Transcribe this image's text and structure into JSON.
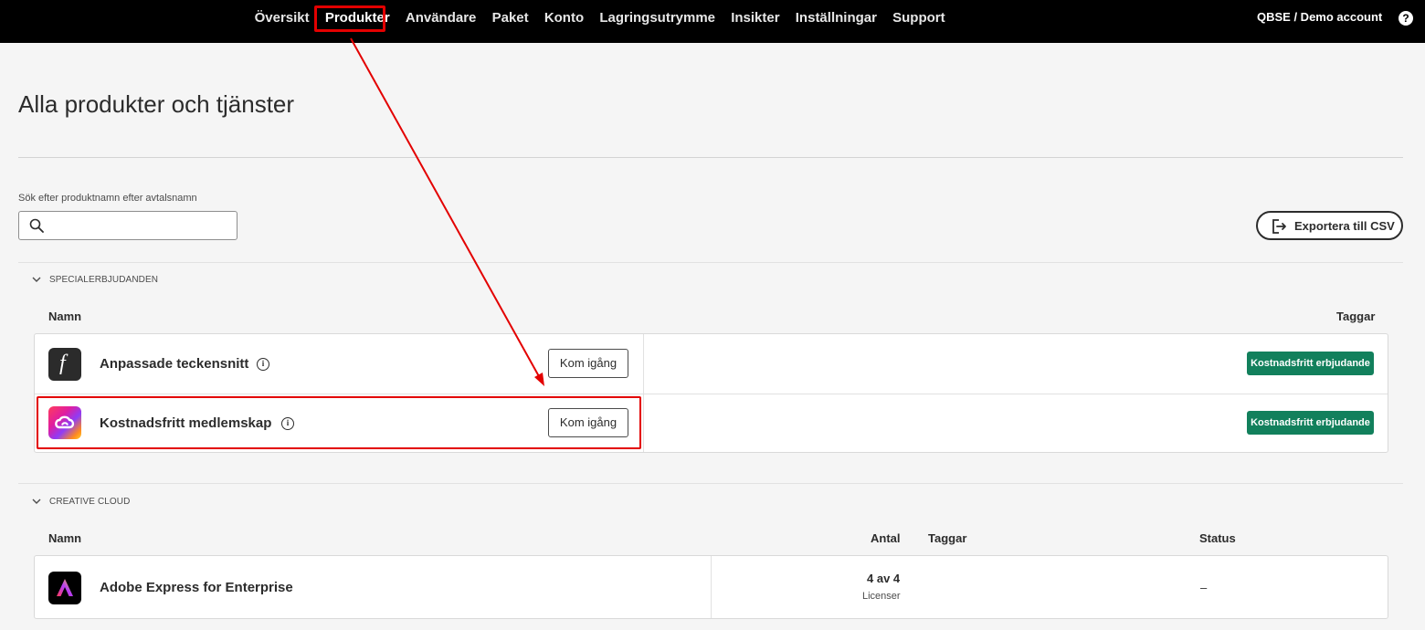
{
  "nav": {
    "items": [
      {
        "label": "Översikt"
      },
      {
        "label": "Produkter"
      },
      {
        "label": "Användare"
      },
      {
        "label": "Paket"
      },
      {
        "label": "Konto"
      },
      {
        "label": "Lagringsutrymme"
      },
      {
        "label": "Insikter"
      },
      {
        "label": "Inställningar"
      },
      {
        "label": "Support"
      }
    ],
    "active": "Produkter",
    "account": "QBSE / Demo account",
    "help": "?"
  },
  "page": {
    "title": "Alla produkter och tjänster",
    "search_label": "Sök efter produktnamn efter avtalsnamn",
    "search_placeholder": "",
    "export_label": "Exportera till CSV"
  },
  "special": {
    "section_title": "SPECIALERBJUDANDEN",
    "col_name": "Namn",
    "col_tags": "Taggar",
    "rows": [
      {
        "name": "Anpassade teckensnitt",
        "icon": "font-f-icon",
        "icon_glyph": "f",
        "action": "Kom igång",
        "tag": "Kostnadsfritt erbjudande"
      },
      {
        "name": "Kostnadsfritt medlemskap",
        "icon": "creative-cloud-icon",
        "action": "Kom igång",
        "tag": "Kostnadsfritt erbjudande"
      }
    ]
  },
  "creative_cloud": {
    "section_title": "CREATIVE CLOUD",
    "col_name": "Namn",
    "col_qty": "Antal",
    "col_tags": "Taggar",
    "col_status": "Status",
    "rows": [
      {
        "name": "Adobe Express for Enterprise",
        "icon": "adobe-express-icon",
        "qty": "4 av 4",
        "qty_unit": "Licenser",
        "status": "–"
      }
    ]
  },
  "info_glyph": "i",
  "colors": {
    "tag_bg": "#12805c",
    "annotation": "#e30000",
    "topbar": "#000000"
  }
}
